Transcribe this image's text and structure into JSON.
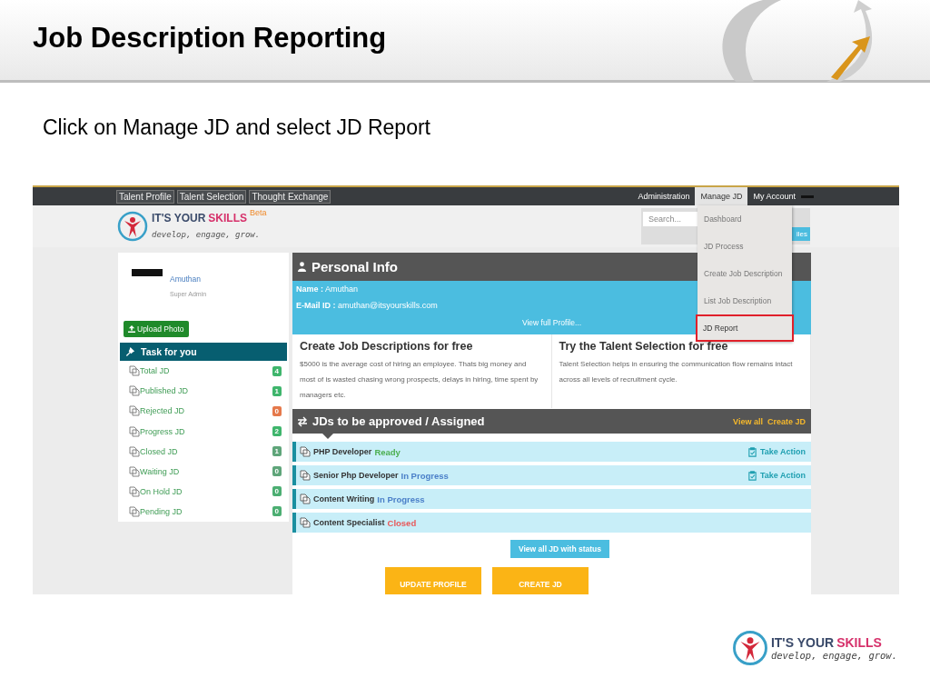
{
  "slide": {
    "title": "Job Description Reporting",
    "instruction": "Click on Manage JD and select JD Report"
  },
  "app": {
    "nav_left": [
      "Talent Profile",
      "Talent Selection",
      "Thought Exchange"
    ],
    "nav_right": [
      {
        "label": "Administration",
        "selected": false
      },
      {
        "label": "Manage JD",
        "selected": true
      },
      {
        "label": "My Account",
        "selected": false
      }
    ],
    "logo": {
      "part1": "IT'S YOUR",
      "part2": "SKILLS",
      "badge": "Beta",
      "tagline": "develop, engage, grow."
    },
    "search": {
      "placeholder": "Search..."
    },
    "search_button": "iles",
    "menu": [
      {
        "label": "Dashboard",
        "selected": false
      },
      {
        "label": "JD Process",
        "selected": false
      },
      {
        "label": "Create Job Description",
        "selected": false
      },
      {
        "label": "List Job Description",
        "selected": false
      },
      {
        "label": "JD Report",
        "selected": true
      }
    ],
    "profile": {
      "name": "Amuthan",
      "role": "Super Admin",
      "upload_button": "Upload Photo"
    },
    "tasks": {
      "title": "Task for you",
      "items": [
        {
          "label": "Total JD",
          "count": "4",
          "color": "#3fb56c"
        },
        {
          "label": "Published JD",
          "count": "1",
          "color": "#3fb56c"
        },
        {
          "label": "Rejected JD",
          "count": "0",
          "color": "#e5794b"
        },
        {
          "label": "Progress JD",
          "count": "2",
          "color": "#3fb56c"
        },
        {
          "label": "Closed JD",
          "count": "1",
          "color": "#5fa57a"
        },
        {
          "label": "Waiting JD",
          "count": "0",
          "color": "#5fa57a"
        },
        {
          "label": "On Hold JD",
          "count": "0",
          "color": "#4cae72"
        },
        {
          "label": "Pending JD",
          "count": "0",
          "color": "#4cae72"
        }
      ]
    },
    "personal_info": {
      "title": "Personal Info",
      "name_label": "Name :",
      "name": "Amuthan",
      "email_label": "E-Mail ID :",
      "email": "amuthan@itsyourskills.com",
      "link": "View full Profile..."
    },
    "promos": [
      {
        "title": "Create Job Descriptions for free",
        "text": "$5000 is the average cost of hiring an employee. Thats big money and most of is wasted chasing wrong prospects, delays in hiring, time spent by managers etc."
      },
      {
        "title": "Try the Talent Selection for free",
        "text": "Talent Selection helps in ensuring the communication flow remains intact across all levels of recruitment cycle."
      }
    ],
    "jds": {
      "title": "JDs to be approved / Assigned",
      "links": [
        "View all",
        "Create JD"
      ],
      "rows": [
        {
          "title": "PHP Developer",
          "status": "Ready",
          "color": "#4caf50",
          "action": "Take Action"
        },
        {
          "title": "Senior Php Developer",
          "status": "In Progress",
          "color": "#4a7fc8",
          "action": "Take Action"
        },
        {
          "title": "Content Writing",
          "status": "In Progress",
          "color": "#4a7fc8"
        },
        {
          "title": "Content Specialist",
          "status": "Closed",
          "color": "#e8585a"
        }
      ],
      "button": "View all JD with status"
    },
    "buttons": [
      "UPDATE PROFILE",
      "CREATE JD"
    ]
  },
  "footer_logo": {
    "part1": "IT'S YOUR",
    "part2": "SKILLS",
    "tagline": "develop, engage, grow."
  }
}
